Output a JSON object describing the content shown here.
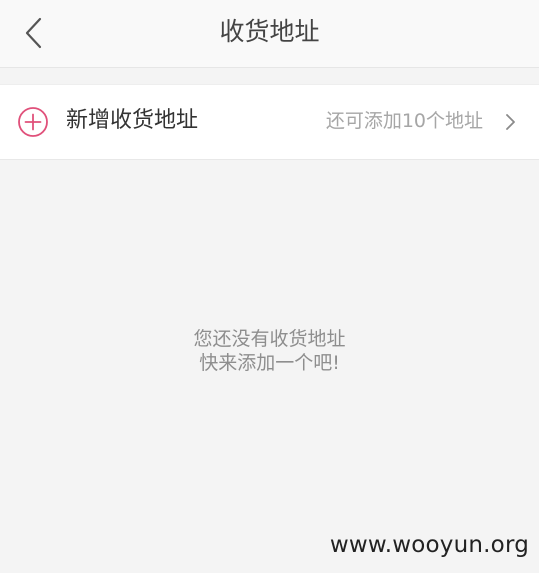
{
  "nav": {
    "title": "收货地址",
    "back_icon": "chevron-left-icon"
  },
  "add_address": {
    "icon": "plus-circle-icon",
    "label": "新增收货地址",
    "remaining": "还可添加10个地址",
    "chevron_icon": "chevron-right-icon",
    "accent_color": "#e0507a"
  },
  "empty_state": {
    "line1": "您还没有收货地址",
    "line2": "快来添加一个吧!"
  },
  "watermark": "www.wooyun.org"
}
